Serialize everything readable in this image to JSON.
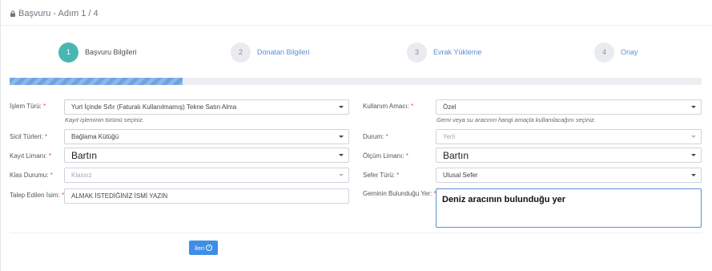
{
  "header": {
    "title": "Başvuru - Adım 1 / 4",
    "icon": "lock-icon"
  },
  "steps": [
    {
      "number": "1",
      "label": "Başvuru Bilgileri",
      "active": true
    },
    {
      "number": "2",
      "label": "Donatan Bilgileri",
      "active": false
    },
    {
      "number": "3",
      "label": "Evrak Yükleme",
      "active": false
    },
    {
      "number": "4",
      "label": "Onay",
      "active": false
    }
  ],
  "progress": {
    "percent": 25,
    "color": "#6fa3e0"
  },
  "form": {
    "islem_turu": {
      "label": "İşlem Türü:",
      "value": "Yurt İçinde Sıfır (Faturalı Kullanılmamış) Tekne Satın Alma",
      "hint": "Kayıt işleminin türünü seçiniz."
    },
    "sicil_turleri": {
      "label": "Sicil Türleri:",
      "value": "Bağlama Kütüğü"
    },
    "kayit_limani": {
      "label": "Kayıt Limanı:",
      "value": "Bartın"
    },
    "klas_durumu": {
      "label": "Klas Durumu:",
      "value": "Klassız"
    },
    "talep_edilen_isim": {
      "label": "Talep Edilen İsim:",
      "value": "ALMAK İSTEDİĞİNİZ İSMİ YAZIN"
    },
    "kullanim_amaci": {
      "label": "Kullanım Amacı:",
      "value": "Özel",
      "hint": "Gemi veya su aracının hangi amaçla kullanılacağını seçiniz."
    },
    "durum": {
      "label": "Durum:",
      "value": "Yerli"
    },
    "olcum_limani": {
      "label": "Ölçüm Limanı:",
      "value": "Bartın"
    },
    "sefer_turu": {
      "label": "Sefer Türü:",
      "value": "Ulusal Sefer"
    },
    "geminin_bulundugu_yer": {
      "label": "Geminin Bulunduğu Yer:",
      "value": "Deniz aracının bulunduğu yer"
    },
    "required_mark": "*"
  },
  "buttons": {
    "next_label": "İleri"
  },
  "colors": {
    "accent": "#49b6b3",
    "link": "#5d8fd6",
    "primary": "#3e8ee6",
    "required": "#e04b4b"
  }
}
